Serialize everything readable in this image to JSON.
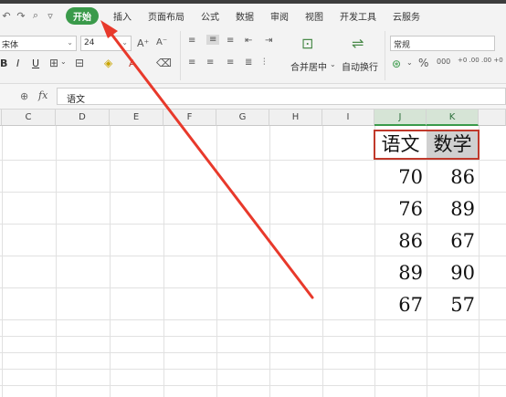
{
  "quick_access": [
    "↶",
    "↷",
    "🔍",
    "▿"
  ],
  "tabs": [
    "开始",
    "插入",
    "页面布局",
    "公式",
    "数据",
    "审阅",
    "视图",
    "开发工具",
    "云服务"
  ],
  "ribbon": {
    "font_name": "宋体",
    "font_size": "24",
    "grow_font": "A⁺",
    "shrink_font": "A⁻",
    "bold": "B",
    "italic": "I",
    "underline": "U",
    "merge_center": "合并居中",
    "wrap_text": "自动换行",
    "number_format": "常规",
    "percent": "%",
    "thousands": "000",
    "inc_decimal": "+0 .00",
    "dec_decimal": ".00 +0"
  },
  "formula_bar": {
    "fx_label": "fx",
    "value": "语文"
  },
  "columns": [
    "C",
    "D",
    "E",
    "F",
    "G",
    "H",
    "I",
    "J",
    "K"
  ],
  "table": {
    "headers": [
      "语文",
      "数学"
    ],
    "rows": [
      [
        "70",
        "86"
      ],
      [
        "76",
        "89"
      ],
      [
        "86",
        "67"
      ],
      [
        "89",
        "90"
      ],
      [
        "67",
        "57"
      ]
    ]
  },
  "colors": {
    "active_tab": "#3a9a4a",
    "selection_border": "#c0392b",
    "arrow": "#e8392b"
  }
}
